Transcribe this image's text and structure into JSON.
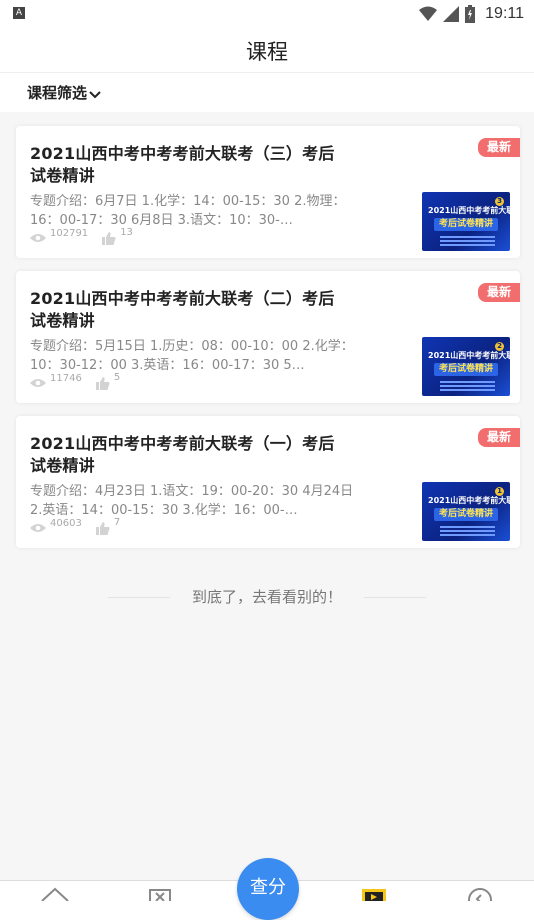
{
  "status_bar": {
    "time": "19:11",
    "app_icon_letter": "A"
  },
  "header": {
    "title": "课程"
  },
  "filter": {
    "label": "课程筛选"
  },
  "courses": [
    {
      "title": "2021山西中考中考考前大联考（三）考后试卷精讲",
      "description": "专题介绍：6月7日 1.化学：14：00-15：30 2.物理：16：00-17：30 6月8日 3.语文：10：30-…",
      "badge": "最新",
      "views": "102791",
      "likes": "13",
      "thumb_num": "3",
      "thumb_title": "2021山西中考考前大联考",
      "thumb_subtitle": "考后试卷精讲"
    },
    {
      "title": "2021山西中考中考考前大联考（二）考后试卷精讲",
      "description": "专题介绍：5月15日 1.历史：08：00-10：00 2.化学：10：30-12：00 3.英语：16：00-17：30 5…",
      "badge": "最新",
      "views": "11746",
      "likes": "5",
      "thumb_num": "2",
      "thumb_title": "2021山西中考考前大联考",
      "thumb_subtitle": "考后试卷精讲"
    },
    {
      "title": "2021山西中考中考考前大联考（一）考后试卷精讲",
      "description": "专题介绍：4月23日 1.语文：19：00-20：30 4月24日 2.英语：14：00-15：30 3.化学：16：00-…",
      "badge": "最新",
      "views": "40603",
      "likes": "7",
      "thumb_num": "1",
      "thumb_title": "2021山西中考考前大联考",
      "thumb_subtitle": "考后试卷精讲"
    }
  ],
  "end_message": "到底了，去看看别的！",
  "tabbar": {
    "center_label": "查分"
  },
  "colors": {
    "accent": "#3b8cf0",
    "badge": "#f26d6d",
    "thumb_bg": "#0b2280"
  }
}
